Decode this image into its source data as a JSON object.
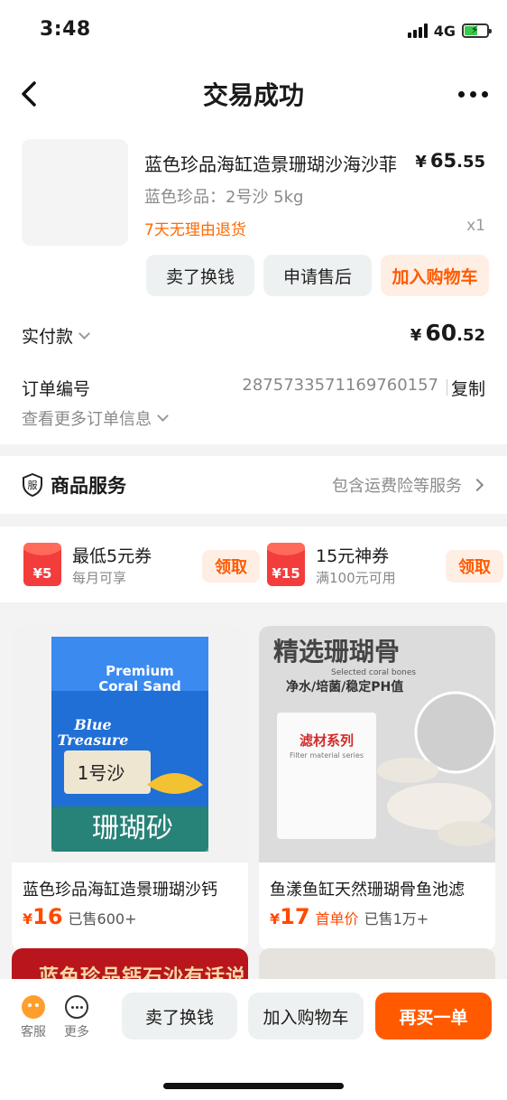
{
  "status_bar": {
    "time": "3:48",
    "network": "4G"
  },
  "nav": {
    "title": "交易成功"
  },
  "order": {
    "product_title": "蓝色珍品海缸造景珊瑚沙海沙菲",
    "price_symbol": "¥",
    "price_int": "65",
    "price_dec": ".55",
    "spec": "蓝色珍品：2号沙 5kg",
    "return_policy": "7天无理由退货",
    "quantity": "x1",
    "buttons": {
      "sell": "卖了换钱",
      "after_sale": "申请售后",
      "add_cart": "加入购物车"
    },
    "paid_label": "实付款",
    "paid_symbol": "¥",
    "paid_int": "60",
    "paid_dec": ".52",
    "order_no_label": "订单编号",
    "order_no": "2875733571169760157",
    "copy_label": "复制",
    "more_info": "查看更多订单信息"
  },
  "service": {
    "icon_text": "服",
    "title": "商品服务",
    "desc": "包含运费险等服务"
  },
  "coupons": [
    {
      "badge": "¥5",
      "title": "最低5元券",
      "sub": "每月可享",
      "action": "领取"
    },
    {
      "badge": "¥15",
      "title": "15元神券",
      "sub": "满100元可用",
      "action": "领取"
    }
  ],
  "recommendations": [
    {
      "image_texts": {
        "brand_line1": "Premium",
        "brand_line2": "Coral Sand",
        "logo1": "Blue",
        "logo2": "Treasure",
        "size_tag": "1号沙",
        "caption": "珊瑚砂"
      },
      "title": "蓝色珍品海缸造景珊瑚沙钙",
      "price_symbol": "¥",
      "price": "16",
      "tag": "",
      "sold": "已售600+"
    },
    {
      "image_texts": {
        "headline": "精选珊瑚骨",
        "sub_en": "Selected coral bones",
        "sub_cn": "净水/培菌/稳定PH值",
        "bag_title": "滤材系列",
        "bag_sub": "Filter material series"
      },
      "title": "鱼漾鱼缸天然珊瑚骨鱼池滤",
      "price_symbol": "¥",
      "price": "17",
      "tag": "首单价",
      "sold": "已售1万+"
    }
  ],
  "rec_partial": {
    "text": "蓝色珍品钙石沙有话说"
  },
  "bottom_bar": {
    "service": "客服",
    "more": "更多",
    "sell": "卖了换钱",
    "cart": "加入购物车",
    "rebuy": "再买一单"
  },
  "colors": {
    "accent": "#ff5a00",
    "accent_light": "#ffeee4",
    "coupon_red": "#f33c3c",
    "text_muted": "#8a8a8a"
  }
}
